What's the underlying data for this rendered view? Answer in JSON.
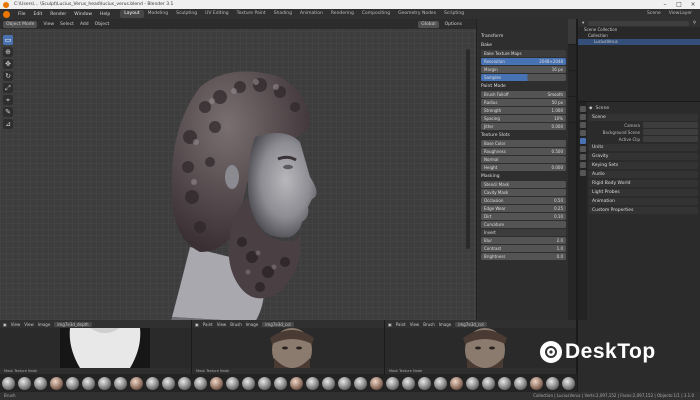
{
  "window": {
    "title": "C:\\Users\\... \\Sculpt\\Lucius_Verus_head\\lucius_verus.blend - Blender 3.1",
    "controls": [
      "minimize",
      "maximize",
      "close"
    ]
  },
  "menubar": {
    "menus": [
      "File",
      "Edit",
      "Render",
      "Window",
      "Help"
    ],
    "workspaces": [
      "Layout",
      "Modeling",
      "Sculpting",
      "UV Editing",
      "Texture Paint",
      "Shading",
      "Animation",
      "Rendering",
      "Compositing",
      "Geometry Nodes",
      "Scripting"
    ],
    "active_workspace": "Layout",
    "scene": "Scene",
    "view_layer": "ViewLayer"
  },
  "viewport": {
    "mode": "Object Mode",
    "menus": [
      "View",
      "Select",
      "Add",
      "Object"
    ],
    "orientation": "Global",
    "options": "Options"
  },
  "npanel": {
    "sections": [
      {
        "title": "Transform",
        "rows": []
      },
      {
        "title": "Bake",
        "rows": [
          {
            "label": "Bake Texture Maps",
            "value": "",
            "style": "dark"
          },
          {
            "label": "Resolution",
            "value": "2048×2048",
            "style": "blue"
          },
          {
            "label": "Margin",
            "value": "16 px",
            "style": "row"
          },
          {
            "label": "Samples",
            "value": "",
            "style": "slider"
          }
        ]
      },
      {
        "title": "Paint Mode",
        "rows": [
          {
            "label": "Brush Falloff",
            "value": "Smooth",
            "style": "row"
          },
          {
            "label": "Radius",
            "value": "50 px",
            "style": "row"
          },
          {
            "label": "Strength",
            "value": "1.000",
            "style": "row"
          },
          {
            "label": "Spacing",
            "value": "10%",
            "style": "row"
          },
          {
            "label": "Jitter",
            "value": "0.000",
            "style": "row"
          }
        ]
      },
      {
        "title": "Texture Slots",
        "rows": [
          {
            "label": "Base Color",
            "value": "",
            "style": "row"
          },
          {
            "label": "Roughness",
            "value": "0.500",
            "style": "row"
          },
          {
            "label": "Normal",
            "value": "",
            "style": "row"
          },
          {
            "label": "Height",
            "value": "0.000",
            "style": "row"
          }
        ]
      },
      {
        "title": "Masking",
        "rows": [
          {
            "label": "Stencil Mask",
            "value": "",
            "style": "row"
          },
          {
            "label": "Cavity Mask",
            "value": "",
            "style": "row"
          },
          {
            "label": "Occlusion",
            "value": "0.50",
            "style": "row"
          },
          {
            "label": "Edge Wear",
            "value": "0.25",
            "style": "row"
          },
          {
            "label": "Dirt",
            "value": "0.10",
            "style": "row"
          },
          {
            "label": "Curvature",
            "value": "",
            "style": "row"
          },
          {
            "label": "Invert",
            "value": "",
            "style": "dark"
          },
          {
            "label": "Blur",
            "value": "2.0",
            "style": "row"
          },
          {
            "label": "Contrast",
            "value": "1.0",
            "style": "row"
          },
          {
            "label": "Brightness",
            "value": "0.0",
            "style": "row"
          }
        ]
      }
    ]
  },
  "outliner": {
    "search_placeholder": "",
    "rows": [
      "Scene Collection",
      "Collection",
      "LuciusVerus"
    ],
    "selected_index": 2
  },
  "properties": {
    "title": "Scene",
    "sections": [
      {
        "title": "Scene",
        "fields": [
          "Camera",
          "Background Scene",
          "Active Clip"
        ]
      },
      {
        "title": "Units",
        "fields": []
      },
      {
        "title": "Gravity",
        "fields": []
      },
      {
        "title": "Keying Sets",
        "fields": []
      },
      {
        "title": "Audio",
        "fields": []
      },
      {
        "title": "Rigid Body World",
        "fields": []
      },
      {
        "title": "Light Probes",
        "fields": []
      },
      {
        "title": "Animation",
        "fields": []
      },
      {
        "title": "Custom Properties",
        "fields": []
      }
    ]
  },
  "image_editors": [
    {
      "view": "View",
      "menus": [
        "View",
        "Image"
      ],
      "image": "img7e3d_depth",
      "footer": "Mask Texture Node"
    },
    {
      "view": "Paint",
      "menus": [
        "View",
        "Brush",
        "Image"
      ],
      "image": "img7e3d_col",
      "footer": "Mask Texture Node"
    },
    {
      "view": "Paint",
      "menus": [
        "View",
        "Brush",
        "Image"
      ],
      "image": "img7e3d_col",
      "footer": "Mask Texture Node"
    }
  ],
  "statusbar": {
    "left": "Brush",
    "right": "Collection | LuciusVerus | Verts:2,097,152 | Faces:2,097,152 | Objects:1/1 | 3.1.0"
  },
  "watermark": {
    "text": "esk",
    "text2": "Top",
    "letter": "D"
  },
  "brush_count": 36
}
